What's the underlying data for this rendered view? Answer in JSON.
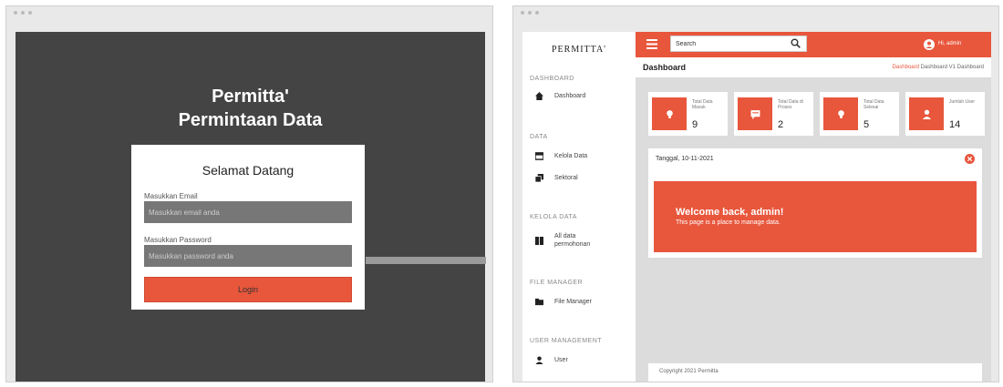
{
  "login_app": {
    "title_line1": "Permitta'",
    "title_line2": "Permintaan Data",
    "welcome": "Selamat Datang",
    "email_label": "Masukkan Email",
    "email_placeholder": "Masukkan email anda",
    "password_label": "Masukkan Password",
    "password_placeholder": "Masukkan password anda",
    "login_button": "Login"
  },
  "dashboard_app": {
    "brand": "PERMITTA'",
    "sidebar": {
      "sections": [
        {
          "title": "DASHBOARD",
          "items": [
            {
              "label": "Dashboard",
              "icon": "home-icon"
            }
          ]
        },
        {
          "title": "DATA",
          "items": [
            {
              "label": "Kelola Data",
              "icon": "database-icon"
            },
            {
              "label": "Sektoral",
              "icon": "copy-icon"
            }
          ]
        },
        {
          "title": "KELOLA DATA",
          "items": [
            {
              "label": "All data permohonan",
              "icon": "book-icon"
            }
          ]
        },
        {
          "title": "FILE MANAGER",
          "items": [
            {
              "label": "File Manager",
              "icon": "folder-icon"
            }
          ]
        },
        {
          "title": "USER MANAGEMENT",
          "items": [
            {
              "label": "User",
              "icon": "user-icon"
            }
          ]
        }
      ]
    },
    "topbar": {
      "search_value": "Search",
      "user_name": "Hi, admin"
    },
    "header": {
      "page_title": "Dashboard",
      "breadcrumb_active": "Dashboard",
      "breadcrumb_rest": " Dashboard V1 Dashboard"
    },
    "stats": [
      {
        "label": "Total Data Masuk",
        "value": "9",
        "icon": "lightbulb-icon"
      },
      {
        "label": "Total Data di Proses",
        "value": "2",
        "icon": "chat-icon"
      },
      {
        "label": "Total Data Selesai",
        "value": "5",
        "icon": "lightbulb-icon"
      },
      {
        "label": "Jumlah User",
        "value": "14",
        "icon": "user-icon"
      }
    ],
    "panel": {
      "date_label": "Tanggal, 10-11-2021",
      "banner_title": "Welcome back, admin!",
      "banner_subtitle": "This page is a place to manage data."
    },
    "footer": {
      "copyright": "Copyright 2021 Permitta"
    }
  },
  "colors": {
    "accent": "#e8563c",
    "login_bg": "#444444",
    "input_bg": "#777777",
    "main_bg": "#dcdcdc"
  }
}
